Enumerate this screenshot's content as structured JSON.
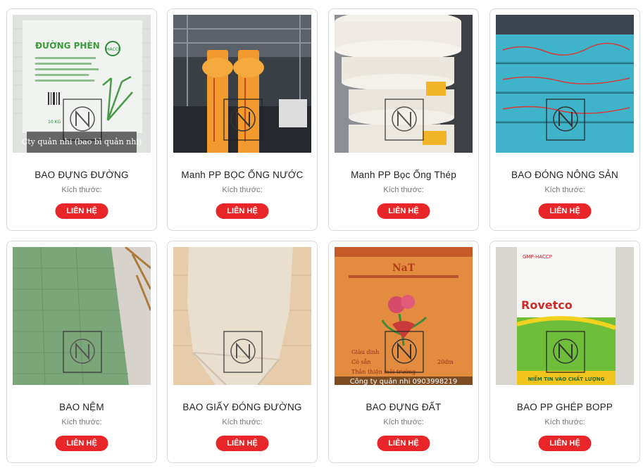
{
  "products": [
    {
      "name": "BAO ĐỰNG ĐƯỜNG",
      "size_label": "Kích thước:",
      "button": "LIÊN HỆ",
      "image_caption": "Cty quản nhi (bao bì quản nhi)",
      "image_texts": [
        "ĐƯỜNG PHÈN",
        "HACCP",
        "10 KG"
      ]
    },
    {
      "name": "Manh PP BỌC ỐNG NƯỚC",
      "size_label": "Kích thước:",
      "button": "LIÊN HỆ"
    },
    {
      "name": "Manh PP Bọc Ống Thép",
      "size_label": "Kích thước:",
      "button": "LIÊN HỆ"
    },
    {
      "name": "BAO ĐÓNG NÔNG SẢN",
      "size_label": "Kích thước:",
      "button": "LIÊN HỆ"
    },
    {
      "name": "BAO NỆM",
      "size_label": "Kích thước:",
      "button": "LIÊN HỆ"
    },
    {
      "name": "BAO GIẤY ĐÓNG ĐƯỜNG",
      "size_label": "Kích thước:",
      "button": "LIÊN HỆ"
    },
    {
      "name": "BAO ĐỰNG ĐẤT",
      "size_label": "Kích thước:",
      "button": "LIÊN HỆ",
      "image_caption": "Công ty quản nhi 0903998219",
      "image_texts": [
        "NaT",
        "Giàu dinh",
        "Có sẵn",
        "Thân thiện môi trường",
        "20dm"
      ]
    },
    {
      "name": "BAO PP GHÉP BOPP",
      "size_label": "Kích thước:",
      "button": "LIÊN HỆ",
      "image_texts": [
        "GMP-HACCP",
        "Rovetco",
        "NIỀM TIN VÀO CHẤT LƯỢNG"
      ]
    }
  ],
  "watermark": "QUẢN NHI",
  "colors": {
    "button": "#e8262a",
    "border": "#d9d9d9"
  }
}
